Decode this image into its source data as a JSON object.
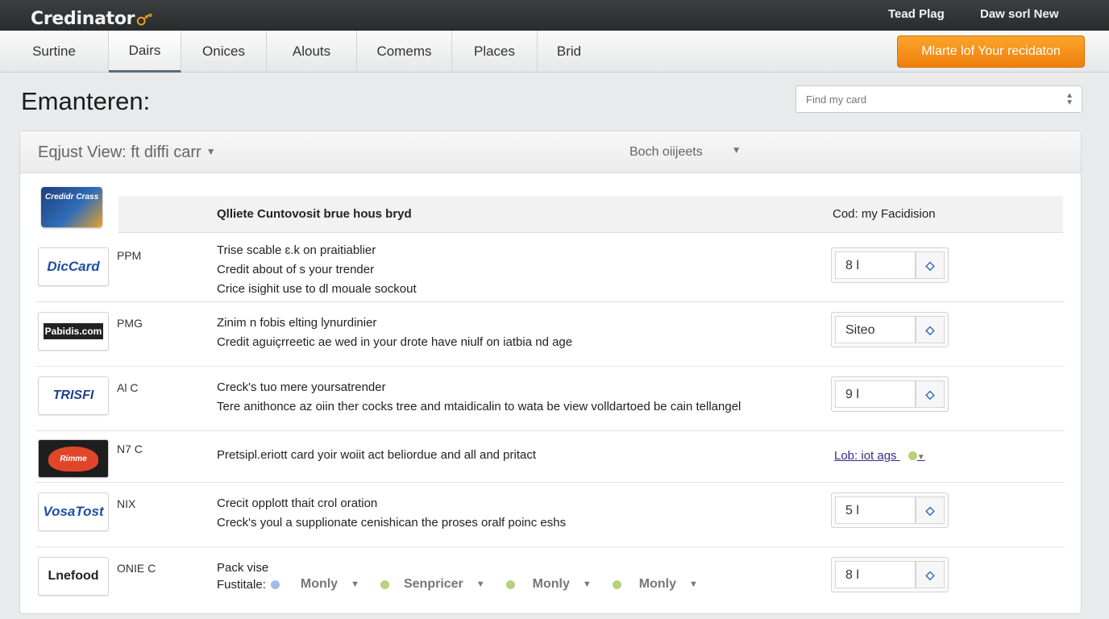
{
  "app": {
    "name": "Credinator"
  },
  "topbar": {
    "link_1": "Tead Plag",
    "link_2": "Daw sorl New"
  },
  "nav": {
    "tabs": [
      {
        "label": "Surtine"
      },
      {
        "label": "Dairs"
      },
      {
        "label": "Onices"
      },
      {
        "label": "Alouts"
      },
      {
        "label": "Comems"
      },
      {
        "label": "Places"
      },
      {
        "label": "Brid"
      }
    ],
    "active_tab": "Dairs",
    "cta_label": "Mlarte lof Your recidaton"
  },
  "page": {
    "title": "Emanteren:"
  },
  "search": {
    "placeholder": "Find my card"
  },
  "panel": {
    "view_label": "Eqjust View: ft diffi carr",
    "filter_label": "Boch oiijeets",
    "header_card_text": "Credidr Crass",
    "columns": {
      "description": "Qlliete Cuntovosit brue hous bryd",
      "action": "Cod: my Facidision"
    }
  },
  "rows": [
    {
      "brand": "DicCard",
      "code": "PPM",
      "lines": [
        "Trise scable ɛ.k on praitiablier",
        "Credit about of s your trender",
        "Crice isighit use to dl mouale sockout"
      ],
      "value": "8 l"
    },
    {
      "brand": "Pabidis.com",
      "code": "PMG",
      "lines": [
        "Zinim n fobis elting lynurdinier",
        "Credit aguiçrreetic ae wed in your drote have niulf on iatbia nd age"
      ],
      "value": "Siteo"
    },
    {
      "brand": "TRISFI",
      "code": "Al C",
      "lines": [
        "Creck's tuo mere yoursatrender",
        "Tere anithonce az oiin ther cocks tree and mtaidicalin to wata be view volldartoed be cain tellangel"
      ],
      "value": "9 l"
    },
    {
      "brand": "Rimme",
      "code": "N7 C",
      "lines": [
        "Pretsipl.eriott card yoir woiit act beliordue and all and pritact"
      ],
      "link": "Lob: iot ags"
    },
    {
      "brand": "VosaTost",
      "code": "NIX",
      "lines": [
        "Crecit opplott thait crol oration",
        "Creck's youl a supplionate cenishican the proses oralf poinc eshs"
      ],
      "value": "5 l"
    },
    {
      "brand": "Lnefood",
      "code": "ONIE C",
      "lines": [
        "Pack vise"
      ],
      "options_label": "Fustitale:",
      "options": [
        "Monly",
        "Senpricer",
        "Monly",
        "Monly"
      ],
      "value": "8 l"
    }
  ],
  "colors": {
    "accent": "#f08a14",
    "topbar": "#2f3032",
    "link": "#3c2a8a",
    "stepper_icon": "#2160b8",
    "dot": "#b6d27a"
  }
}
